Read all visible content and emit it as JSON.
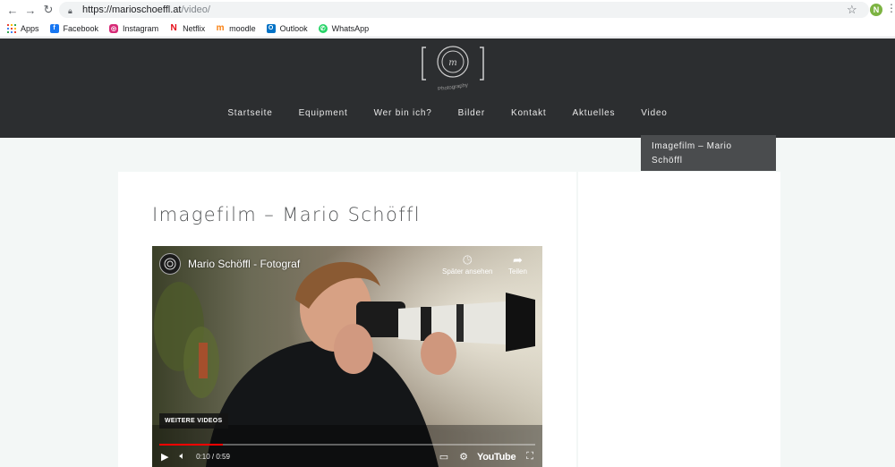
{
  "browser": {
    "url_host": "https://marioschoeffl.at",
    "url_path": "/video/",
    "profile_initial": "N"
  },
  "bookmarks": [
    {
      "label": "Apps",
      "icon": "apps-grid-icon"
    },
    {
      "label": "Facebook",
      "icon": "facebook-icon",
      "color": "#1877f2",
      "glyph": "f"
    },
    {
      "label": "Instagram",
      "icon": "instagram-icon",
      "color": "#d62976",
      "glyph": "◎"
    },
    {
      "label": "Netflix",
      "icon": "netflix-icon",
      "color": "#e50914",
      "glyph": "N"
    },
    {
      "label": "moodle",
      "icon": "moodle-icon",
      "color": "#f98012",
      "glyph": "m"
    },
    {
      "label": "Outlook",
      "icon": "outlook-icon",
      "color": "#0072c6",
      "glyph": "O"
    },
    {
      "label": "WhatsApp",
      "icon": "whatsapp-icon",
      "color": "#25d366",
      "glyph": "✆"
    }
  ],
  "site": {
    "logo_text": "Photography",
    "nav": [
      {
        "label": "Startseite"
      },
      {
        "label": "Equipment"
      },
      {
        "label": "Wer bin ich?"
      },
      {
        "label": "Bilder"
      },
      {
        "label": "Kontakt"
      },
      {
        "label": "Aktuelles"
      },
      {
        "label": "Video"
      }
    ],
    "dropdown": [
      "Imagefilm – Mario",
      "Schöffl"
    ]
  },
  "post": {
    "title": "Imagefilm – Mario Schöffl"
  },
  "video": {
    "channel_title": "Mario Schöffl - Fotograf",
    "watch_later": "Später ansehen",
    "share": "Teilen",
    "more_videos": "WEITERE VIDEOS",
    "time": "0:10 / 0:59",
    "progress": 0.17,
    "brand": "YouTube"
  },
  "colors": {
    "header_bg": "#2c2e30",
    "page_bg": "#f3f7f6",
    "progress_red": "#ff0000"
  }
}
